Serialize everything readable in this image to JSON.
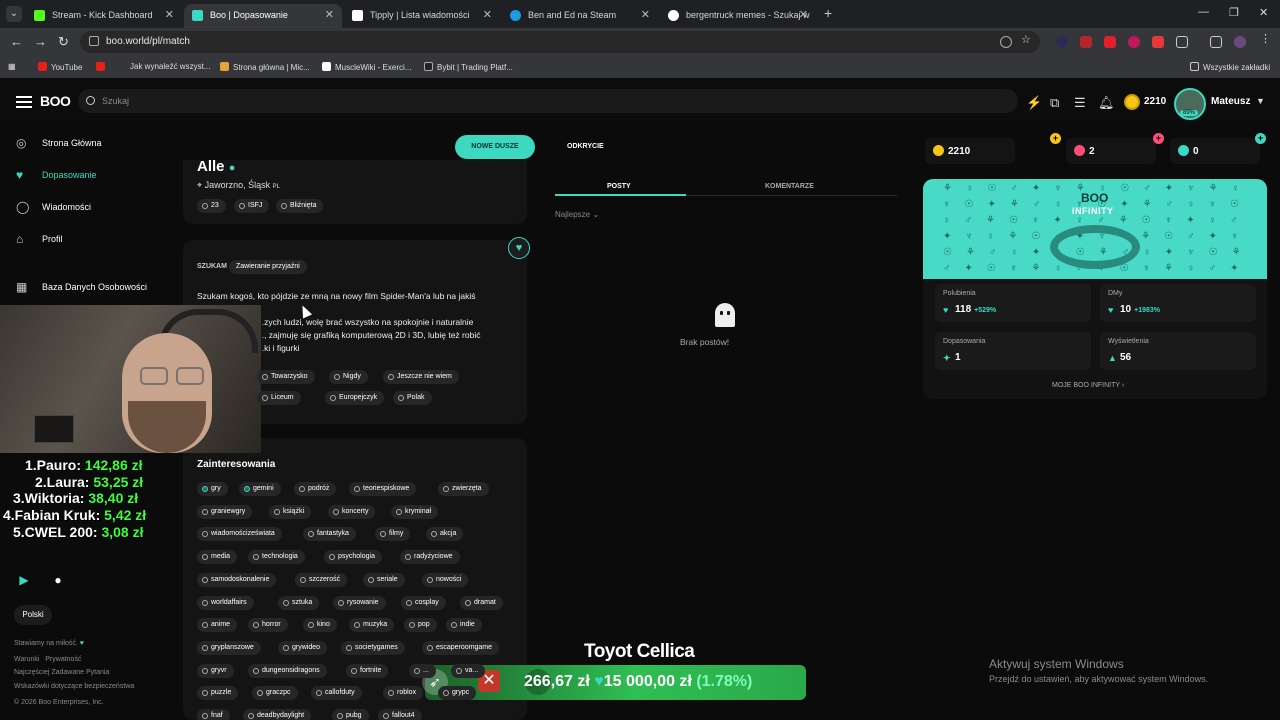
{
  "browser": {
    "tabs": [
      {
        "title": "Stream - Kick Dashboard",
        "color": "#53fc18"
      },
      {
        "title": "Boo | Dopasowanie",
        "color": "#3cd8c0"
      },
      {
        "title": "Tipply | Lista wiadomości",
        "color": "#ffffff"
      },
      {
        "title": "Ben and Ed na Steam",
        "color": "#1b9be0"
      },
      {
        "title": "bergentruck memes - Szukaj w",
        "color": "#ffffff"
      }
    ],
    "url": "boo.world/pl/match",
    "bookmarks": [
      "YouTube",
      "Jak wynaleźć wszyst...",
      "Strona główna | Mic...",
      "MuscleWiki - Exerci...",
      "Bybit | Trading Platf..."
    ],
    "all_bookmarks": "Wszystkie zakładki"
  },
  "header": {
    "logo": "BOO",
    "search_placeholder": "Szukaj",
    "coins": "2210",
    "avatar_badge": "89%",
    "username": "Mateusz"
  },
  "sidebar": {
    "items": [
      {
        "label": "Strona Główna",
        "icon": "compass-icon"
      },
      {
        "label": "Dopasowanie",
        "icon": "heart-icon"
      },
      {
        "label": "Wiadomości",
        "icon": "chat-icon"
      },
      {
        "label": "Profil",
        "icon": "user-icon"
      },
      {
        "label": "Baza Danych Osobowości",
        "icon": "grid-icon"
      }
    ]
  },
  "leaderboard": [
    {
      "name": "1.Pauro:",
      "amount": "142,86 zł"
    },
    {
      "name": "2.Laura:",
      "amount": "53,25 zł"
    },
    {
      "name": "3.Wiktoria:",
      "amount": "38,40 zł"
    },
    {
      "name": "4.Fabian Kruk:",
      "amount": "5,42 zł"
    },
    {
      "name": "5.CWEL 200:",
      "amount": "3,08 zł"
    }
  ],
  "footer": {
    "language": "Polski",
    "made_with": "Stawiamy na miłość.",
    "terms": "Warunki",
    "privacy": "Prywatność",
    "faq": "Najczęściej Zadawane Pytania",
    "safety": "Wskazówki dotyczące bezpieczeństwa",
    "copyright": "© 2026 Boo Enterprises, Inc."
  },
  "profile": {
    "name": "Alle",
    "location": "Jaworzno, Śląsk",
    "country": "PL",
    "pills": [
      "23",
      "ISFJ",
      "Bliźnięta"
    ],
    "seeking_label": "SZUKAM",
    "seeking_value": "Zawieranie przyjaźni",
    "bio_lines": [
      "Szukam kogoś, kto pójdzie ze mną na nowy film Spider-Man'a lub na jakiś",
      "...zych ludzi, wolę brać wszystko na spokojnie i naturalnie",
      "..., zajmuję się grafiką komputerową 2D i 3D, lubię też robić",
      "...ki i figurki"
    ],
    "traits_row1": [
      "Towarzysko",
      "Nigdy",
      "Jeszcze nie wiem"
    ],
    "traits_row2": [
      "Liceum",
      "Europejczyk",
      "Polak"
    ],
    "interests_title": "Zainteresowania",
    "interests": [
      [
        "gry",
        "gemini",
        "podróż",
        "teoriespiskowe",
        "zwierzęta"
      ],
      [
        "graniewgry",
        "książki",
        "koncerty",
        "kryminał"
      ],
      [
        "wiadomościzeświata",
        "fantastyka",
        "filmy",
        "akcja"
      ],
      [
        "media",
        "technologia",
        "psychologia",
        "radyżyciowe"
      ],
      [
        "samodoskonalenie",
        "szczerość",
        "seriale",
        "nowości"
      ],
      [
        "worldaffairs",
        "sztuka",
        "rysowanie",
        "cosplay",
        "dramat"
      ],
      [
        "anime",
        "horror",
        "kino",
        "muzyka",
        "pop",
        "indie"
      ],
      [
        "gryplanszowe",
        "grywideo",
        "societygames",
        "escaperoomgame"
      ],
      [
        "gryvr",
        "dungeonsidragons",
        "fortnite",
        "...",
        "va..."
      ],
      [
        "puzzle",
        "graczpc",
        "callofduty",
        "roblox",
        "grypc"
      ],
      [
        "fnaf",
        "deadbydaylight",
        "pubg",
        "fallout4"
      ]
    ]
  },
  "posts": {
    "new_souls": "NOWE DUSZE",
    "discovery": "ODKRYCIE",
    "tab_posts": "POSTY",
    "tab_comments": "KOMENTARZE",
    "sort": "Najlepsze",
    "empty": "Brak postów!"
  },
  "right": {
    "coins": "2210",
    "hearts": "2",
    "boosts": "0",
    "infinity_logo": "BOO",
    "infinity_sub": "INFINITY",
    "likes_label": "Polubienia",
    "likes_val": "118",
    "likes_change": "+529%",
    "dms_label": "DMy",
    "dms_val": "10",
    "dms_change": "+1983%",
    "matches_label": "Dopasowania",
    "matches_val": "1",
    "views_label": "Wyświetlenia",
    "views_val": "56",
    "my_infinity": "MOJE BOO INFINITY"
  },
  "overlay": {
    "title": "Toyot Cellica",
    "current": "266,67 zł",
    "goal": "15 000,00 zł",
    "percent": "(1.78%)",
    "progress": 0.0178
  },
  "windows": {
    "activate_title": "Aktywuj system Windows",
    "activate_sub": "Przejdź do ustawień, aby aktywować system Windows."
  },
  "colors": {
    "accent": "#3cd8c0",
    "money": "#3cff3c",
    "background": "#0b0b0b"
  }
}
